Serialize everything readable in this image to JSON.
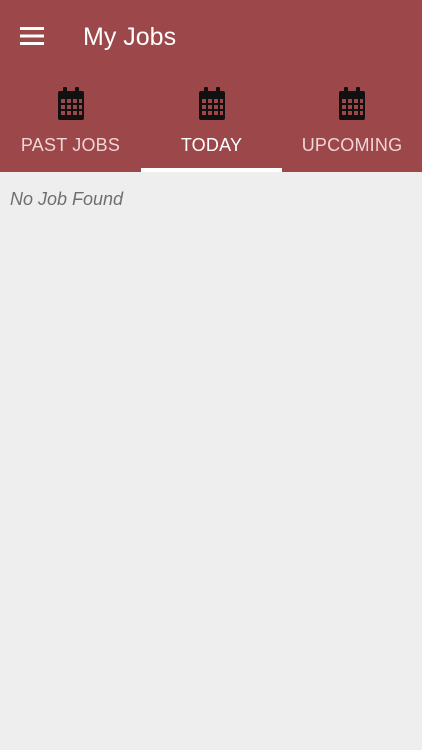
{
  "header": {
    "title": "My Jobs",
    "menu_icon": "hamburger-menu-icon",
    "background_color": "#9c4749"
  },
  "tabs": [
    {
      "label": "PAST JOBS",
      "icon": "calendar-icon",
      "active": false
    },
    {
      "label": "TODAY",
      "icon": "calendar-icon",
      "active": true
    },
    {
      "label": "UPCOMING",
      "icon": "calendar-icon",
      "active": false
    }
  ],
  "content": {
    "empty_message": "No Job Found"
  }
}
